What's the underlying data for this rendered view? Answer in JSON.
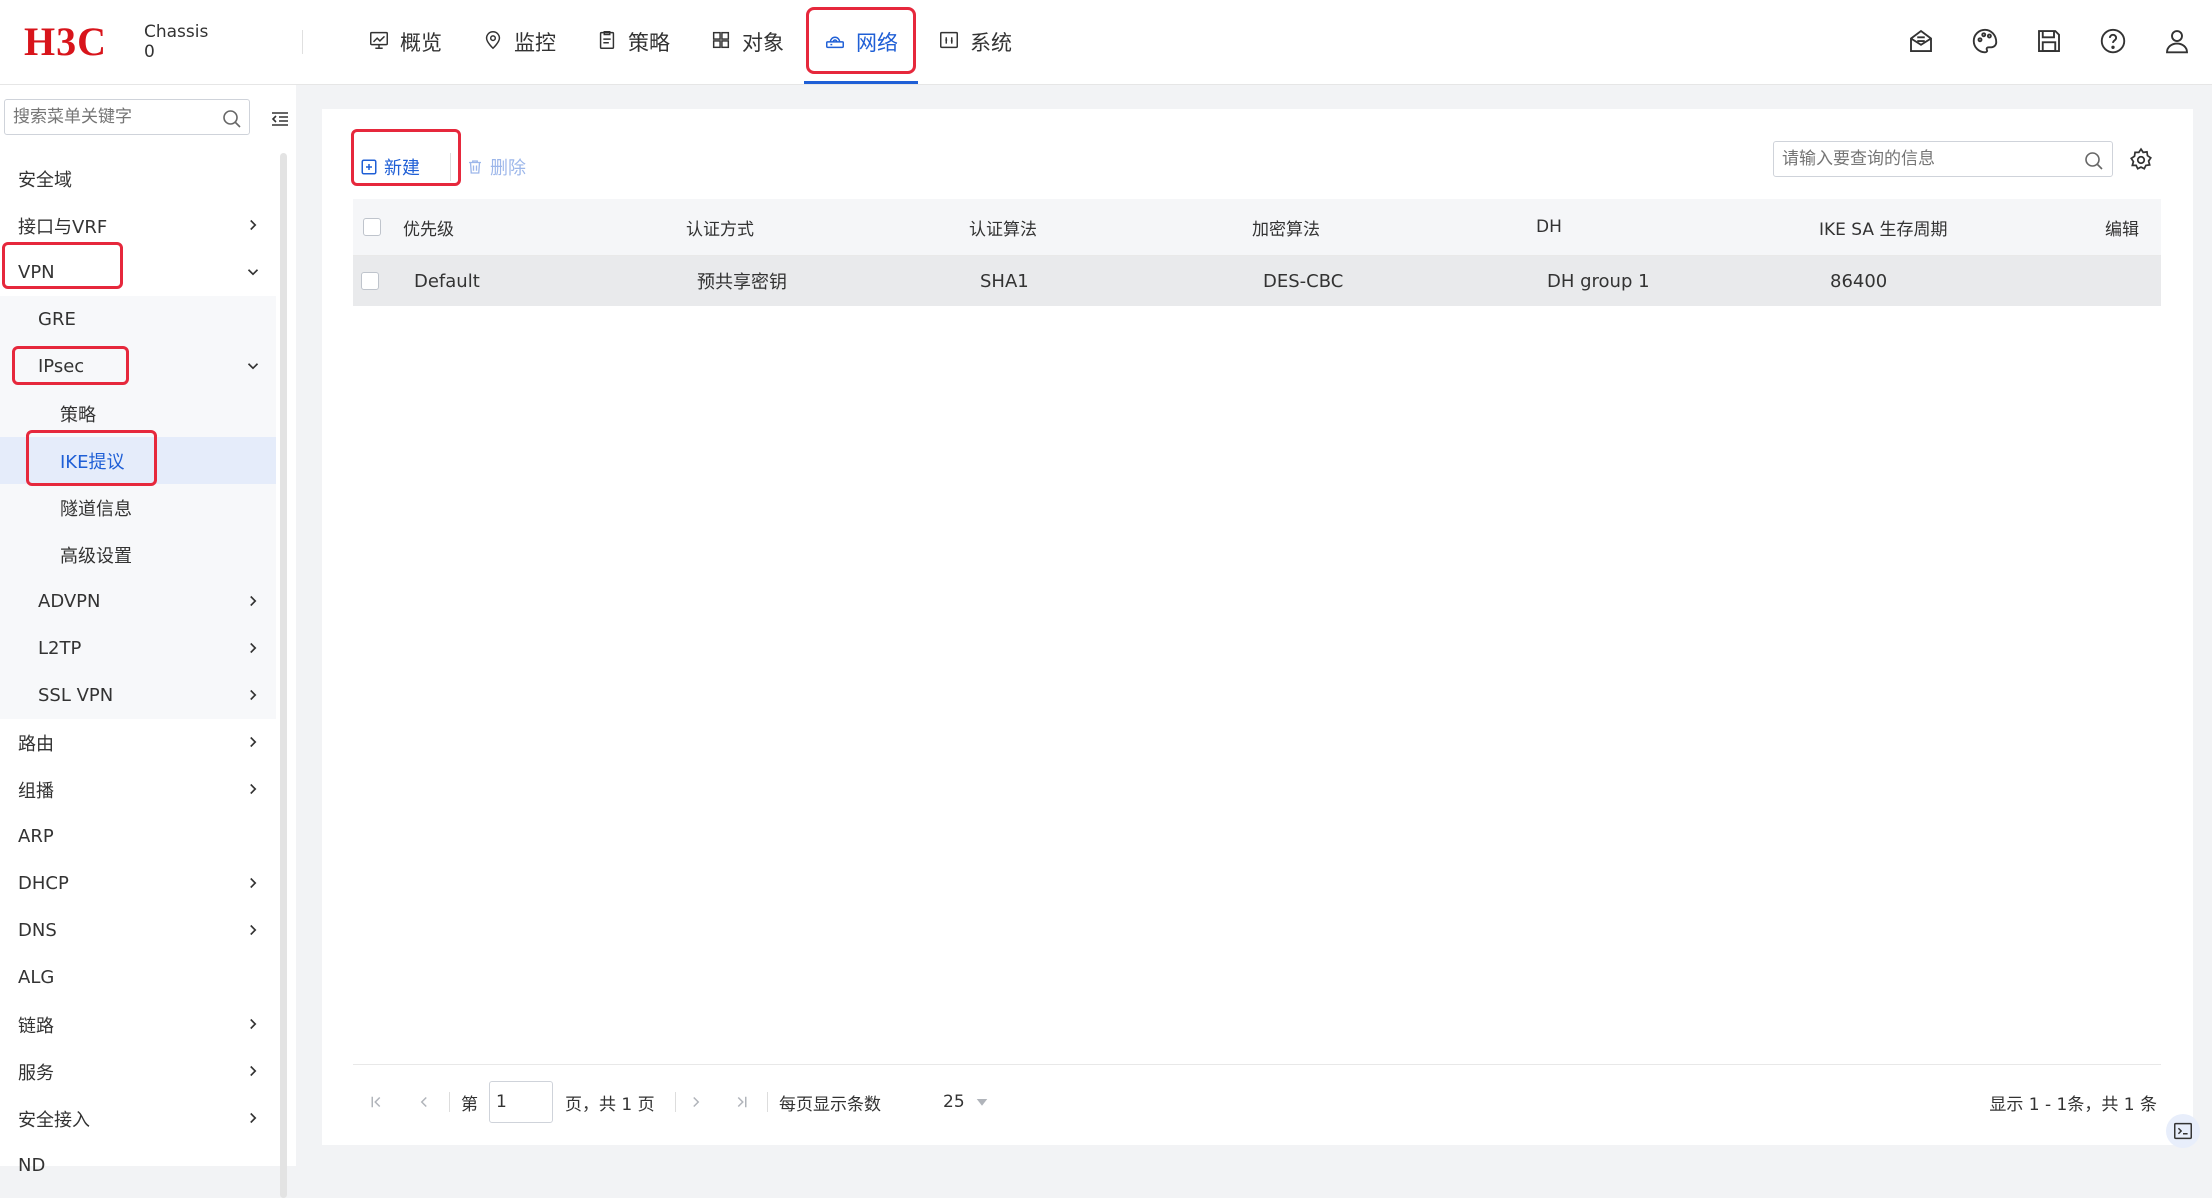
{
  "header": {
    "logo": "H3C",
    "chassis_line1": "Chassis",
    "chassis_line2": "0",
    "nav": [
      {
        "label": "概览",
        "icon": "dashboard-icon"
      },
      {
        "label": "监控",
        "icon": "monitor-icon"
      },
      {
        "label": "策略",
        "icon": "policy-icon"
      },
      {
        "label": "对象",
        "icon": "object-icon"
      },
      {
        "label": "网络",
        "icon": "network-icon",
        "active": true
      },
      {
        "label": "系统",
        "icon": "system-icon"
      }
    ],
    "right_icons": [
      "message-icon",
      "theme-icon",
      "save-icon",
      "help-icon",
      "user-icon"
    ]
  },
  "sidebar": {
    "search_placeholder": "搜索菜单关键字",
    "items": [
      {
        "label": "安全域"
      },
      {
        "label": "接口与VRF"
      },
      {
        "label": "VPN"
      },
      {
        "label": "GRE"
      },
      {
        "label": "IPsec"
      },
      {
        "label": "策略"
      },
      {
        "label": "IKE提议"
      },
      {
        "label": "隧道信息"
      },
      {
        "label": "高级设置"
      },
      {
        "label": "ADVPN"
      },
      {
        "label": "L2TP"
      },
      {
        "label": "SSL VPN"
      },
      {
        "label": "路由"
      },
      {
        "label": "组播"
      },
      {
        "label": "ARP"
      },
      {
        "label": "DHCP"
      },
      {
        "label": "DNS"
      },
      {
        "label": "ALG"
      },
      {
        "label": "链路"
      },
      {
        "label": "服务"
      },
      {
        "label": "安全接入"
      },
      {
        "label": "ND"
      }
    ]
  },
  "toolbar": {
    "new_label": "新建",
    "delete_label": "删除",
    "search_placeholder": "请输入要查询的信息"
  },
  "table": {
    "columns": [
      "优先级",
      "认证方式",
      "认证算法",
      "加密算法",
      "DH",
      "IKE SA 生存周期",
      "编辑"
    ],
    "rows": [
      [
        "Default",
        "预共享密钥",
        "SHA1",
        "DES-CBC",
        "DH group 1",
        "86400"
      ]
    ]
  },
  "pager": {
    "page_prefix": "第",
    "page_value": "1",
    "page_suffix": "页，共 1 页",
    "per_page_label": "每页显示条数",
    "per_page_value": "25",
    "summary": "显示 1 - 1条，共 1 条"
  },
  "colors": {
    "accent": "#1f5fd6",
    "highlight": "#e6283c",
    "brand": "#d8141b"
  }
}
